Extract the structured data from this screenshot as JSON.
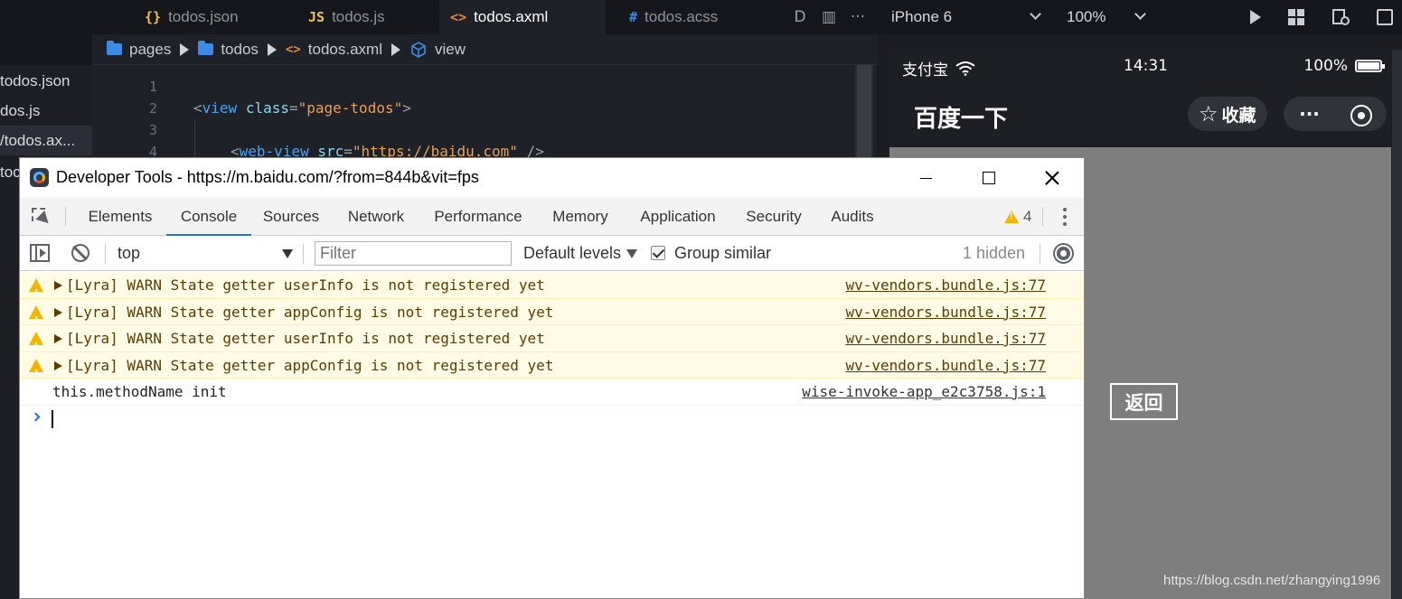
{
  "ide": {
    "tabs": [
      {
        "glyph": "{}",
        "label": "todos.json",
        "color": "#f0c34a"
      },
      {
        "glyph": "JS",
        "label": "todos.js",
        "color": "#f0c34a"
      },
      {
        "glyph": "<>",
        "label": "todos.axml",
        "color": "#e2883a"
      },
      {
        "glyph": "#",
        "label": "todos.acss",
        "color": "#3c8ce7"
      }
    ],
    "tab_tools": [
      "D",
      "▥",
      "···"
    ],
    "sidebar_files": [
      {
        "label": "todos.json"
      },
      {
        "label": "dos.js"
      },
      {
        "label": "/todos.ax..."
      },
      {
        "label": "toc"
      }
    ],
    "breadcrumb": [
      "pages",
      "todos",
      "todos.axml",
      "view"
    ],
    "line_numbers": [
      "1",
      "2",
      "3",
      "4"
    ],
    "code": {
      "l2_open": "<",
      "l2_tag": "view",
      "l2_attr": "class",
      "l2_eq": "=",
      "l2_val": "\"page-todos\"",
      "l2_close": ">",
      "l4_open": "<",
      "l4_tag": "web-view",
      "l4_attr": "src",
      "l4_eq": "=",
      "l4_val": "\"https://baidu.com\"",
      "l4_close": " />"
    }
  },
  "simulator": {
    "device": "iPhone 6",
    "zoom": "100%",
    "status": {
      "carrier": "支付宝",
      "time": "14:31",
      "battery": "100%"
    },
    "page_title": "百度一下",
    "favorite_label": "收藏",
    "more_label": "···",
    "back_button": "返回",
    "watermark": "https://blog.csdn.net/zhangying1996"
  },
  "devtools": {
    "window_title": "Developer Tools - https://m.baidu.com/?from=844b&vit=fps",
    "tabs": [
      "Elements",
      "Console",
      "Sources",
      "Network",
      "Performance",
      "Memory",
      "Application",
      "Security",
      "Audits"
    ],
    "active_tab": "Console",
    "warning_count": "4",
    "context": "top",
    "filter_placeholder": "Filter",
    "levels": "Default levels",
    "group_similar": "Group similar",
    "group_similar_checked": true,
    "hidden_count": "1 hidden",
    "messages": [
      {
        "type": "warn",
        "text": "[Lyra] WARN State getter userInfo is not registered yet",
        "source": "wv-vendors.bundle.js:77"
      },
      {
        "type": "warn",
        "text": "[Lyra] WARN State getter appConfig is not registered yet",
        "source": "wv-vendors.bundle.js:77"
      },
      {
        "type": "warn",
        "text": "[Lyra] WARN State getter userInfo is not registered yet",
        "source": "wv-vendors.bundle.js:77"
      },
      {
        "type": "warn",
        "text": "[Lyra] WARN State getter appConfig is not registered yet",
        "source": "wv-vendors.bundle.js:77"
      },
      {
        "type": "log",
        "text": "this.methodName init",
        "source": "wise-invoke-app_e2c3758.js:1"
      }
    ],
    "colors": {
      "warn_bg": "#fffbe5",
      "warn_text": "#5c3c00",
      "accent": "#1a73e8",
      "warn_icon": "#f4b400"
    }
  }
}
